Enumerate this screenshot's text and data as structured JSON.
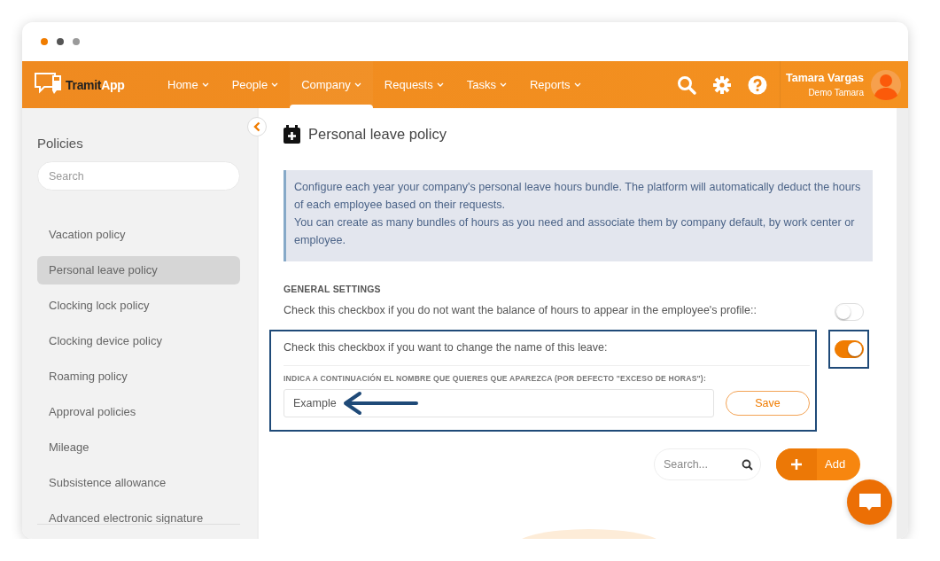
{
  "window": {
    "controls": [
      {
        "color": "#f07c00"
      },
      {
        "color": "#555555"
      },
      {
        "color": "#9a9a9a"
      }
    ]
  },
  "header": {
    "logo": {
      "part_1": "Tramit",
      "part_2": "App"
    },
    "nav": [
      {
        "label": "Home",
        "selected": false
      },
      {
        "label": "People",
        "selected": false
      },
      {
        "label": "Company",
        "selected": true
      },
      {
        "label": "Requests",
        "selected": false
      },
      {
        "label": "Tasks",
        "selected": false
      },
      {
        "label": "Reports",
        "selected": false
      }
    ],
    "user": {
      "name": "Tamara Vargas",
      "company": "Demo Tamara"
    }
  },
  "sidebar": {
    "title": "Policies",
    "search": {
      "placeholder": "Search"
    },
    "items": [
      {
        "label": "Vacation policy",
        "selected": false
      },
      {
        "label": "Personal leave policy",
        "selected": true
      },
      {
        "label": "Clocking lock policy",
        "selected": false
      },
      {
        "label": "Clocking device policy",
        "selected": false
      },
      {
        "label": "Roaming policy",
        "selected": false
      },
      {
        "label": "Approval policies",
        "selected": false
      },
      {
        "label": "Mileage",
        "selected": false
      },
      {
        "label": "Subsistence allowance",
        "selected": false
      },
      {
        "label": "Advanced electronic signature",
        "selected": false
      }
    ]
  },
  "page": {
    "title": "Personal leave policy",
    "info": [
      "Configure each year your company's personal leave hours bundle. The platform will automatically deduct the hours of each employee based on their requests.",
      "You can create as many bundles of hours as you need and associate them by company default, by work center or employee."
    ],
    "section_title": "GENERAL SETTINGS",
    "settings": [
      {
        "label": "Check this checkbox if you do not want the balance of hours to appear in the employee's profile::",
        "on": false,
        "highlighted": false
      },
      {
        "label": "Check this checkbox if you want to change the name of this leave:",
        "on": true,
        "highlighted": true,
        "field": {
          "label": "INDICA A CONTINUACIÓN EL NOMBRE QUE QUIERES QUE APAREZCA (POR DEFECTO \"EXCESO DE HORAS\"):",
          "value": "Example",
          "arrow": true,
          "button": "Save"
        }
      }
    ],
    "search": {
      "placeholder": "Search..."
    },
    "add_button": "Add"
  }
}
